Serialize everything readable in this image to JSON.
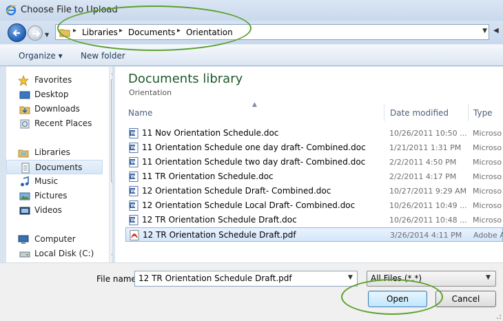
{
  "window": {
    "title": "Choose File to Upload"
  },
  "address": {
    "crumbs": [
      "Libraries",
      "Documents",
      "Orientation"
    ]
  },
  "toolbar": {
    "organize": "Organize ▾",
    "new_folder": "New folder"
  },
  "nav": {
    "favorites": "Favorites",
    "desktop": "Desktop",
    "downloads": "Downloads",
    "recent": "Recent Places",
    "libraries": "Libraries",
    "documents": "Documents",
    "music": "Music",
    "pictures": "Pictures",
    "videos": "Videos",
    "computer": "Computer",
    "local_disk": "Local Disk (C:)"
  },
  "library": {
    "title": "Documents library",
    "subtitle": "Orientation"
  },
  "columns": {
    "name": "Name",
    "date": "Date modified",
    "type": "Type"
  },
  "files": [
    {
      "name": "11 Nov Orientation Schedule.doc",
      "date": "10/26/2011 10:50 ...",
      "type": "Microso",
      "kind": "word-doc-icon"
    },
    {
      "name": "11 Orientation Schedule one day draft- Combined.doc",
      "date": "1/21/2011 1:31 PM",
      "type": "Microso",
      "kind": "word-doc-icon"
    },
    {
      "name": "11 Orientation Schedule two day draft- Combined.doc",
      "date": "2/2/2011 4:50 PM",
      "type": "Microso",
      "kind": "word-doc-icon"
    },
    {
      "name": "11 TR Orientation Schedule.doc",
      "date": "2/2/2011 4:17 PM",
      "type": "Microso",
      "kind": "word-doc-icon"
    },
    {
      "name": "12 Orientation Schedule Draft- Combined.doc",
      "date": "10/27/2011 9:29 AM",
      "type": "Microso",
      "kind": "word-doc-icon"
    },
    {
      "name": "12 Orientation Schedule Local Draft- Combined.doc",
      "date": "10/26/2011 10:49 ...",
      "type": "Microso",
      "kind": "word-doc-icon"
    },
    {
      "name": "12 TR Orientation Schedule Draft.doc",
      "date": "10/26/2011 10:48 ...",
      "type": "Microso",
      "kind": "word-doc-icon"
    },
    {
      "name": "12 TR Orientation Schedule Draft.pdf",
      "date": "3/26/2014 4:11 PM",
      "type": "Adobe A",
      "kind": "pdf-icon",
      "selected": true
    }
  ],
  "bottom": {
    "file_name_label": "File name:",
    "file_name_value": "12 TR Orientation Schedule Draft.pdf",
    "filter": "All Files (*.*)",
    "open": "Open",
    "cancel": "Cancel"
  },
  "colors": {
    "highlight_ellipse": "#5aa02c",
    "library_title": "#1e5a2a",
    "selection": "#d3e6fb"
  }
}
